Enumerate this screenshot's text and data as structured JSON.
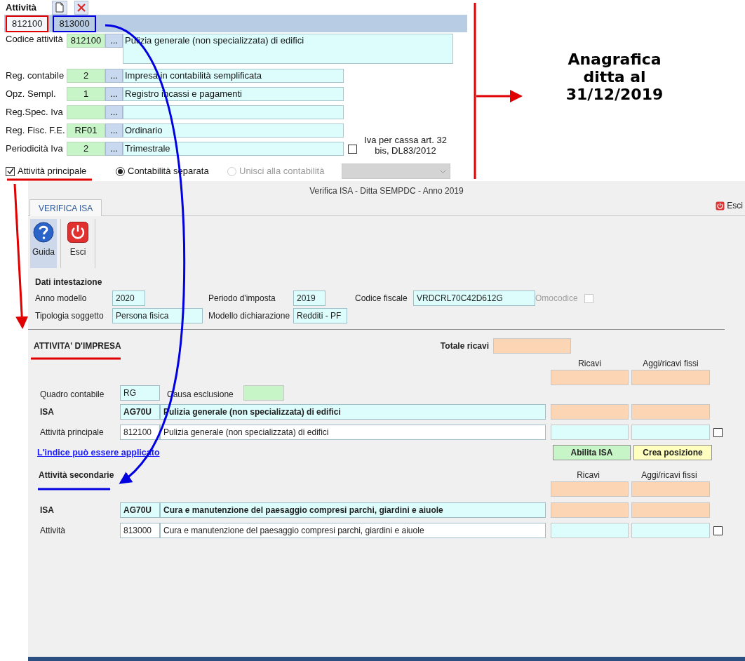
{
  "activity_panel": {
    "title": "Attività",
    "tabs": [
      {
        "label": "812100",
        "selected": true,
        "color": "#e00000"
      },
      {
        "label": "813000",
        "selected": false,
        "color": "#0000e0"
      }
    ],
    "fields": [
      {
        "kind": "tall",
        "label": "Codice attività",
        "code": "812100",
        "button": "...",
        "description": "Pulizia generale (non specializzata) di edifici"
      },
      {
        "kind": "normal",
        "label": "Reg. contabile",
        "code": "2",
        "button": "...",
        "description": "Impresa  in contabilità semplificata"
      },
      {
        "kind": "normal",
        "label": "Opz. Sempl.",
        "code": "1",
        "button": "...",
        "description": "Registro incassi e pagamenti"
      },
      {
        "kind": "normal",
        "label": "Reg.Spec. Iva",
        "button": "..."
      },
      {
        "kind": "normal",
        "label": "Reg. Fisc. F.E.",
        "code": "RF01",
        "button": "...",
        "description": "Ordinario"
      },
      {
        "kind": "normal",
        "label": "Periodicità Iva",
        "code": "2",
        "button": "...",
        "description": "Trimestrale"
      }
    ],
    "iva_per_cassa": {
      "label": "Iva per cassa art. 32 bis, DL83/2012",
      "checked": false
    },
    "main_activity": {
      "label": "Attività principale",
      "checked": true
    },
    "accounting_options": [
      {
        "label": "Contabilità separata",
        "selected": true,
        "disabled": false
      },
      {
        "label": "Unisci alla contabilità",
        "selected": false,
        "disabled": true
      }
    ],
    "merge_dropdown": {
      "disabled": true
    }
  },
  "annotation": {
    "text": "Anagrafica ditta al 31/12/2019"
  },
  "window": {
    "title": "Verifica ISA - Ditta SEMPDC - Anno 2019",
    "tabs": [
      {
        "label": "VERIFICA ISA",
        "selected": true
      }
    ],
    "exit_label": "Esci",
    "toolbar": [
      {
        "kind": "help",
        "label": "Guida",
        "selected": true
      },
      {
        "kind": "exit",
        "label": "Esci",
        "selected": false
      }
    ]
  },
  "header_data": {
    "title": "Dati intestazione",
    "rows": [
      [
        {
          "label": "Anno modello",
          "value": "2020"
        },
        {
          "label": "Periodo d'imposta",
          "value": "2019"
        },
        {
          "label": "Codice fiscale",
          "value": "VRDCRL70C42D612G"
        }
      ],
      [
        {
          "label": "Tipologia soggetto",
          "value": "Persona fisica"
        },
        {
          "label": "Modello dichiarazione",
          "value": "Redditi - PF"
        }
      ]
    ],
    "omocodice": {
      "label": "Omocodice",
      "checked": false,
      "disabled": true
    }
  },
  "business": {
    "title": "ATTIVITA' D'IMPRESA",
    "total_label": "Totale ricavi",
    "column_headers": [
      "Ricavi",
      "Aggi/ricavi fissi"
    ],
    "quadro": {
      "label": "Quadro contabile",
      "value": "RG"
    },
    "exclusion": {
      "label": "Causa esclusione"
    },
    "isa": {
      "label": "ISA",
      "code": "AG70U",
      "description": "Pulizia generale (non specializzata) di edifici"
    },
    "activity": {
      "label": "Attività principale",
      "code": "812100",
      "description": "Pulizia generale (non specializzata) di edifici",
      "checked": false
    },
    "link": "L'indice può essere applicato",
    "buttons": [
      {
        "kind": "enable",
        "label": "Abilita ISA"
      },
      {
        "kind": "create",
        "label": "Crea posizione"
      }
    ]
  },
  "secondary": {
    "title": "Attività secondarie",
    "column_headers": [
      "Ricavi",
      "Aggi/ricavi fissi"
    ],
    "isa": {
      "label": "ISA",
      "code": "AG70U",
      "description": "Cura e manutenzione del paesaggio compresi parchi, giardini e aiuole"
    },
    "activity": {
      "label": "Attività",
      "code": "813000",
      "description": "Cura e manutenzione del paesaggio compresi parchi, giardini e aiuole",
      "checked": false
    }
  }
}
